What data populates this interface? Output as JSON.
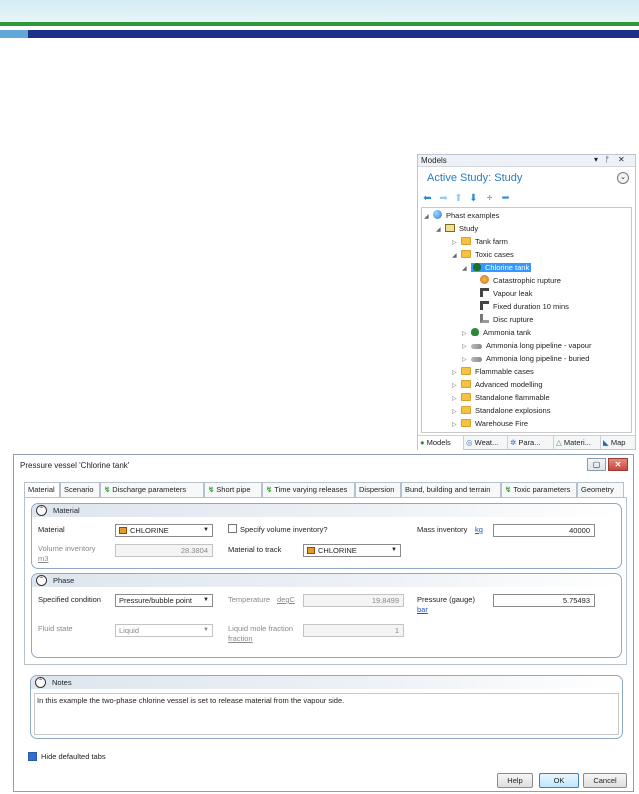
{
  "panel": {
    "title": "Models",
    "title_controls": "▾ ⊓ ✕",
    "active_study": "Active Study: Study",
    "tree": [
      {
        "label": "Phast examples",
        "icon": "globe",
        "expander": "◢"
      },
      {
        "label": "Study",
        "icon": "study",
        "expander": "◢"
      },
      {
        "label": "Tank farm",
        "icon": "folder",
        "expander": "▷"
      },
      {
        "label": "Toxic cases",
        "icon": "folder",
        "expander": "◢"
      },
      {
        "label": "Chlorine tank",
        "icon": "tank",
        "expander": "◢",
        "selected": true
      },
      {
        "label": "Catastrophic rupture",
        "icon": "rupture"
      },
      {
        "label": "Vapour leak",
        "icon": "leak"
      },
      {
        "label": "Fixed duration 10 mins",
        "icon": "leak"
      },
      {
        "label": "Disc rupture",
        "icon": "disc"
      },
      {
        "label": "Ammonia tank",
        "icon": "tank",
        "expander": "▷"
      },
      {
        "label": "Ammonia long pipeline - vapour",
        "icon": "pipe",
        "expander": "▷"
      },
      {
        "label": "Ammonia long pipeline - buried",
        "icon": "pipe",
        "expander": "▷"
      },
      {
        "label": "Flammable cases",
        "icon": "folder",
        "expander": "▷"
      },
      {
        "label": "Advanced modelling",
        "icon": "folder",
        "expander": "▷"
      },
      {
        "label": "Standalone flammable",
        "icon": "folder",
        "expander": "▷"
      },
      {
        "label": "Standalone explosions",
        "icon": "folder",
        "expander": "▷"
      },
      {
        "label": "Warehouse Fire",
        "icon": "folder",
        "expander": "▷"
      }
    ],
    "bottom_tabs": [
      "Models",
      "Weat...",
      "Para...",
      "Materi...",
      "Map"
    ]
  },
  "dialog": {
    "title": "Pressure vessel 'Chlorine tank'",
    "tabs": [
      "Material",
      "Scenario",
      "Discharge parameters",
      "Short pipe",
      "Time varying releases",
      "Dispersion",
      "Bund, building and terrain",
      "Toxic parameters",
      "Geometry"
    ],
    "material": {
      "heading": "Material",
      "material_label": "Material",
      "material_value": "CHLORINE",
      "specify_volume_label": "Specify volume inventory?",
      "mass_inventory_label": "Mass inventory",
      "mass_inventory_unit": "kg",
      "mass_inventory_value": "40000",
      "volume_inventory_label": "Volume inventory",
      "volume_inventory_unit": "m3",
      "volume_inventory_value": "28.3804",
      "material_to_track_label": "Material to track",
      "material_to_track_value": "CHLORINE"
    },
    "phase": {
      "heading": "Phase",
      "specified_condition_label": "Specified condition",
      "specified_condition_value": "Pressure/bubble point",
      "temperature_label": "Temperature",
      "temperature_unit": "degC",
      "temperature_value": "19.8499",
      "pressure_label": "Pressure (gauge)",
      "pressure_unit": "bar",
      "pressure_value": "5.75493",
      "fluid_state_label": "Fluid state",
      "fluid_state_value": "Liquid",
      "liquid_mole_fraction_label": "Liquid mole fraction",
      "liquid_mole_fraction_unit": "fraction",
      "liquid_mole_fraction_value": "1"
    },
    "notes": {
      "heading": "Notes",
      "text": "In this example the two-phase chlorine vessel is set to release material from the vapour side."
    },
    "hide_defaulted_tabs_label": "Hide defaulted tabs",
    "buttons": {
      "help": "Help",
      "ok": "OK",
      "cancel": "Cancel"
    }
  }
}
